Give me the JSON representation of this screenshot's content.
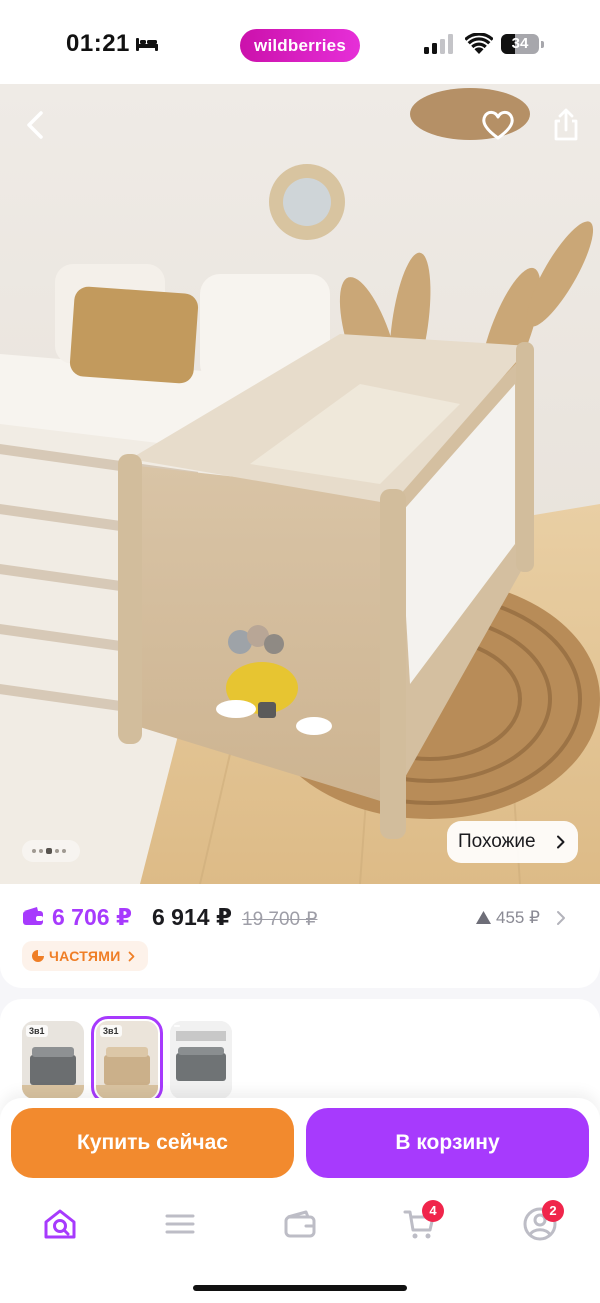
{
  "status_bar": {
    "time": "01:21",
    "brand": "wildberries",
    "battery": "34"
  },
  "hero": {
    "similar_label": "Похожие",
    "icons": [
      "back-icon",
      "heart-icon",
      "share-icon"
    ],
    "slide_count": 5,
    "active_slide": 2
  },
  "price": {
    "wallet_price": "6 706 ₽",
    "price": "6 914 ₽",
    "old_price": "19 700 ₽",
    "trend_value": "455 ₽",
    "installments_label": "ЧАСТЯМИ"
  },
  "variants": {
    "items": [
      {
        "tag": "3в1",
        "color": "gray"
      },
      {
        "tag": "3в1",
        "color": "beige",
        "selected": true
      },
      {
        "tag": "",
        "color": "graphite"
      }
    ]
  },
  "actions": {
    "buy_now": "Купить сейчас",
    "add_to_cart": "В корзину"
  },
  "tab_bar": {
    "items": [
      "home-icon",
      "catalog-icon",
      "wallet-icon",
      "cart-icon",
      "profile-icon"
    ],
    "cart_badge": "4",
    "profile_badge": "2"
  },
  "colors": {
    "brand": "#cb11ab",
    "accent": "#a73afd",
    "buy": "#f28a2e",
    "badge": "#f0254b"
  }
}
